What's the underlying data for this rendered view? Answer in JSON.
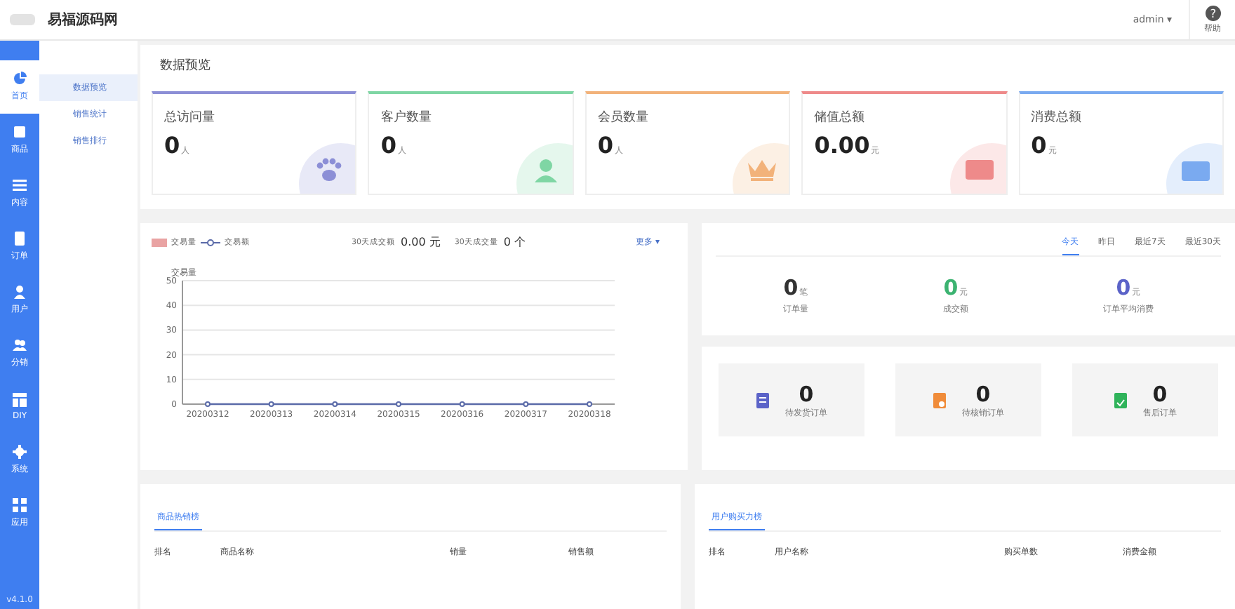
{
  "header": {
    "site_name": "易福源码网",
    "user": "admin",
    "user_caret": "▾",
    "help_icon": "?",
    "help": "帮助"
  },
  "sidebar": {
    "items": [
      {
        "label": "首页",
        "selected": true
      },
      {
        "label": "商品",
        "selected": false
      },
      {
        "label": "内容",
        "selected": false
      },
      {
        "label": "订单",
        "selected": false
      },
      {
        "label": "用户",
        "selected": false
      },
      {
        "label": "分销",
        "selected": false
      },
      {
        "label": "DIY",
        "selected": false
      },
      {
        "label": "系统",
        "selected": false
      },
      {
        "label": "应用",
        "selected": false
      }
    ],
    "version": "v4.1.0"
  },
  "submenu": [
    {
      "label": "数据预览",
      "selected": true
    },
    {
      "label": "销售统计",
      "selected": false
    },
    {
      "label": "销售排行",
      "selected": false
    }
  ],
  "page_title": "数据预览",
  "stat_cards": [
    {
      "label": "总访问量",
      "value": "0",
      "unit": "人",
      "color": "#8c8fd6"
    },
    {
      "label": "客户数量",
      "value": "0",
      "unit": "人",
      "color": "#7fd6a4"
    },
    {
      "label": "会员数量",
      "value": "0",
      "unit": "人",
      "color": "#f2b27a"
    },
    {
      "label": "储值总额",
      "value": "0.00",
      "unit": "元",
      "color": "#ee8a8a"
    },
    {
      "label": "消费总额",
      "value": "0",
      "unit": "元",
      "color": "#7aaaf0"
    }
  ],
  "sales_chart": {
    "summary": [
      {
        "label": "30天成交额",
        "value": "0.00",
        "unit": "元"
      },
      {
        "label": "30天成交量",
        "value": "0",
        "unit": "个"
      }
    ],
    "more": "更多",
    "more_caret": "▾",
    "chart_data": {
      "type": "line",
      "ylabel": "交易量",
      "categories": [
        "20200312",
        "20200313",
        "20200314",
        "20200315",
        "20200316",
        "20200317",
        "20200318"
      ],
      "ylim": [
        0,
        50
      ],
      "yticks": [
        0,
        10,
        20,
        30,
        40,
        50
      ],
      "grid": true,
      "series": [
        {
          "name": "交易量",
          "color": "#e9a3a3",
          "values": [
            null,
            null,
            null,
            null,
            null,
            null,
            null
          ]
        },
        {
          "name": "交易额",
          "color": "#5a6aa8",
          "marker": "circle",
          "values": [
            0,
            0,
            0,
            0,
            0,
            0,
            0
          ]
        }
      ]
    }
  },
  "overview": {
    "tabs": [
      {
        "label": "今天",
        "selected": true
      },
      {
        "label": "昨日",
        "selected": false
      },
      {
        "label": "最近7天",
        "selected": false
      },
      {
        "label": "最近30天",
        "selected": false
      }
    ],
    "stats": [
      {
        "value": "0",
        "unit": "笔",
        "label": "订单量",
        "color": "#333333"
      },
      {
        "value": "0",
        "unit": "元",
        "label": "成交额",
        "color": "#3cb371"
      },
      {
        "value": "0",
        "unit": "元",
        "label": "订单平均消费",
        "color": "#5b63c8"
      }
    ],
    "orders": [
      {
        "value": "0",
        "label": "待发货订单",
        "color": "#5b63c8"
      },
      {
        "value": "0",
        "label": "待核销订单",
        "color": "#f08c3a"
      },
      {
        "value": "0",
        "label": "售后订单",
        "color": "#2fb35a"
      }
    ]
  },
  "rankings": [
    {
      "tab": "商品热销榜",
      "columns": [
        "排名",
        "商品名称",
        "销量",
        "销售额"
      ]
    },
    {
      "tab": "用户购买力榜",
      "columns": [
        "排名",
        "用户名称",
        "购买单数",
        "消费金额"
      ]
    }
  ]
}
